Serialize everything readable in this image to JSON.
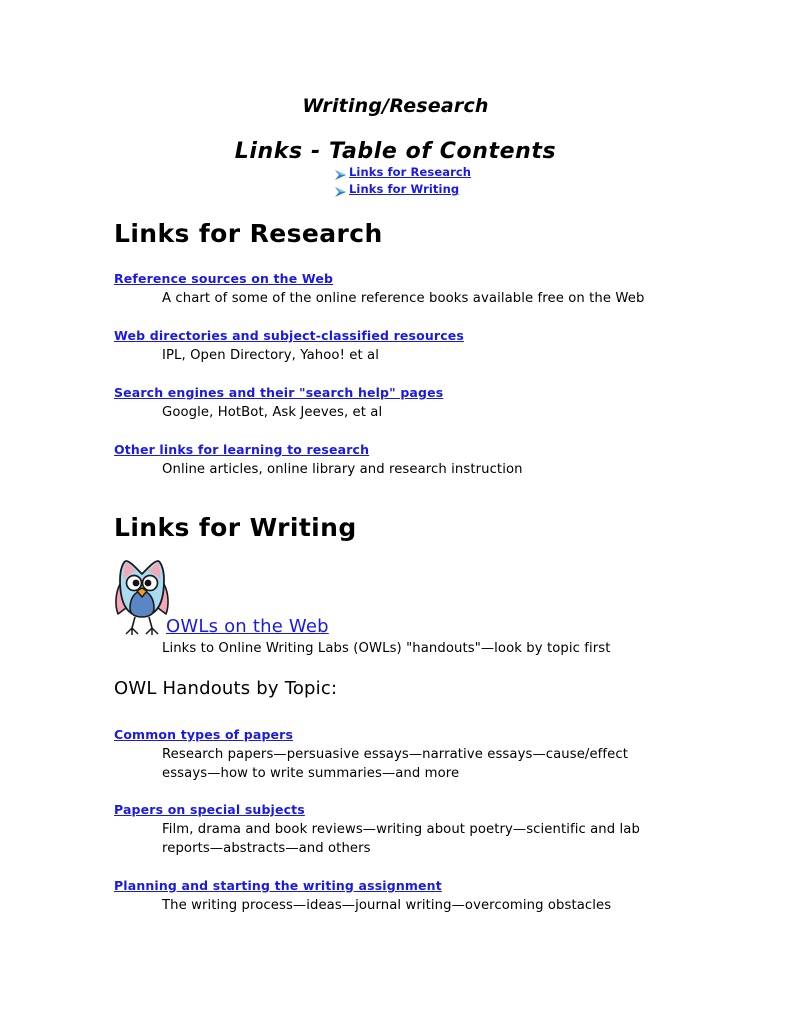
{
  "document": {
    "title": "Writing/Research",
    "toc_title": "Links - Table of Contents"
  },
  "toc": {
    "bullet_icon": "arrow-right-bullet-icon",
    "items": [
      {
        "label": "Links for Research"
      },
      {
        "label": "Links for Writing"
      }
    ]
  },
  "research_section": {
    "heading": "Links for Research",
    "entries": [
      {
        "link": "Reference sources on the Web",
        "description": "A chart of some of the online reference books available free on the Web"
      },
      {
        "link": "Web directories and subject-classified resources",
        "description": "IPL, Open Directory, Yahoo! et al"
      },
      {
        "link": "Search engines and their \"search help\" pages",
        "description": "Google, HotBot, Ask Jeeves, et al"
      },
      {
        "link": "Other links for learning to research",
        "description": "Online articles, online library and research instruction"
      }
    ]
  },
  "writing_section": {
    "heading": "Links for Writing",
    "owl": {
      "icon": "owl-illustration",
      "link": "OWLs on the Web",
      "description": "Links to Online Writing Labs (OWLs) \"handouts\"—look by topic first"
    },
    "subheading": "OWL Handouts by Topic:",
    "entries": [
      {
        "link": "Common types of papers",
        "description": "Research papers—persuasive essays—narrative essays—cause/effect essays—how to write summaries—and more"
      },
      {
        "link": "Papers on special subjects",
        "description": "Film, drama and book reviews—writing about poetry—scientific and lab reports—abstracts—and others"
      },
      {
        "link": "Planning and starting the writing assignment",
        "description": "The writing process—ideas—journal writing—overcoming obstacles"
      }
    ]
  },
  "colors": {
    "link": "#1a1ae6",
    "text": "#000000",
    "background": "#ffffff",
    "bullet_arrow": "#2f7fc4",
    "owl_body": "#a8dcf0",
    "owl_accent": "#f2a8b8",
    "owl_belly": "#5b86c4",
    "owl_beak": "#f0a020"
  }
}
